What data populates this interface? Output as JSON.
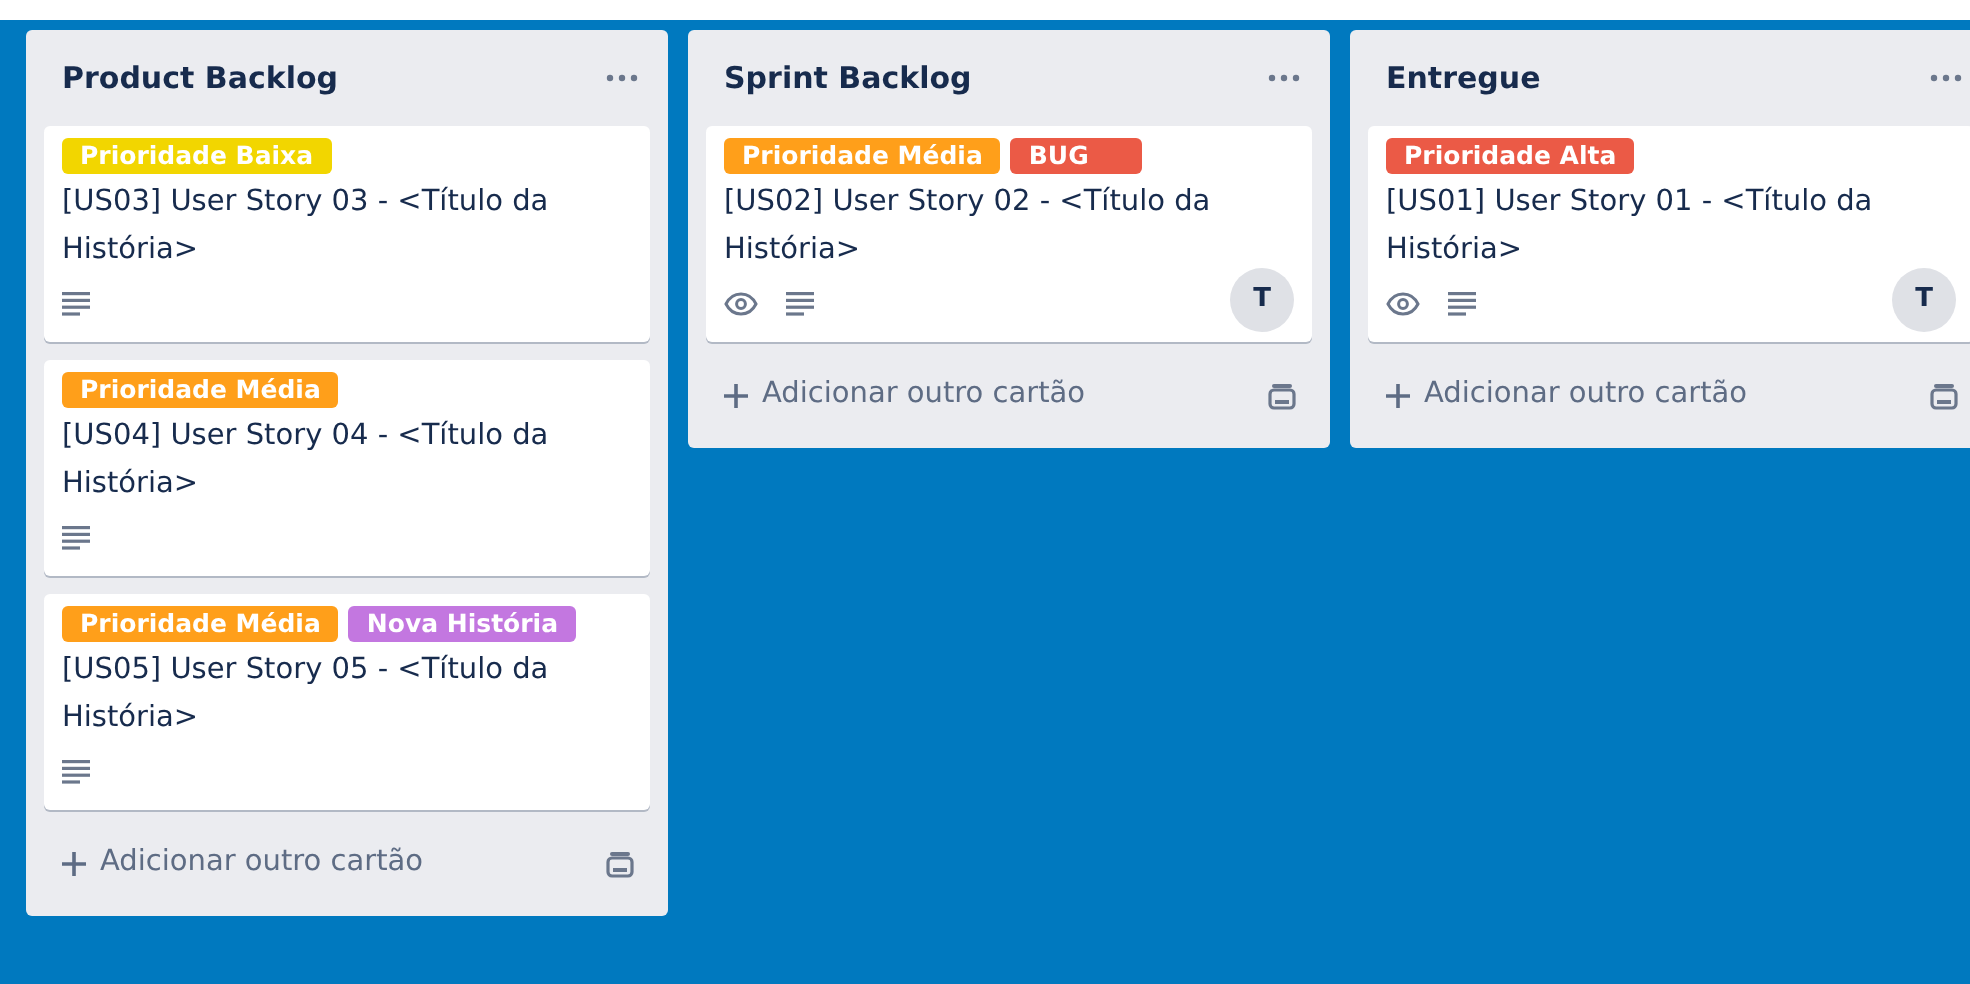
{
  "lists": [
    {
      "title": "Product Backlog",
      "cards": [
        {
          "labels": [
            {
              "text": "Prioridade Baixa",
              "color": "#f2d600"
            }
          ],
          "title": "[US03] User Story 03 - <Título da História>",
          "watched": false,
          "has_description": true
        },
        {
          "labels": [
            {
              "text": "Prioridade Média",
              "color": "#ff9f1a"
            }
          ],
          "title": "[US04] User Story 04 - <Título da História>",
          "watched": false,
          "has_description": true
        },
        {
          "labels": [
            {
              "text": "Prioridade Média",
              "color": "#ff9f1a"
            },
            {
              "text": "Nova História",
              "color": "#c377e0"
            }
          ],
          "title": "[US05] User Story 05 - <Título da História>",
          "watched": false,
          "has_description": true
        }
      ],
      "add_card": "Adicionar outro cartão"
    },
    {
      "title": "Sprint Backlog",
      "cards": [
        {
          "labels": [
            {
              "text": "Prioridade Média",
              "color": "#ff9f1a"
            },
            {
              "text": "BUG",
              "color": "#eb5a46"
            }
          ],
          "title": "[US02] User Story 02 - <Título da História>",
          "watched": true,
          "has_description": true,
          "members": [
            "T"
          ]
        }
      ],
      "add_card": "Adicionar outro cartão"
    },
    {
      "title": "Entregue",
      "cards": [
        {
          "labels": [
            {
              "text": "Prioridade Alta",
              "color": "#eb5a46"
            }
          ],
          "title": "[US01] User Story 01 - <Título da História>",
          "watched": true,
          "has_description": true,
          "members": [
            "T"
          ]
        }
      ],
      "add_card": "Adicionar outro cartão"
    }
  ]
}
